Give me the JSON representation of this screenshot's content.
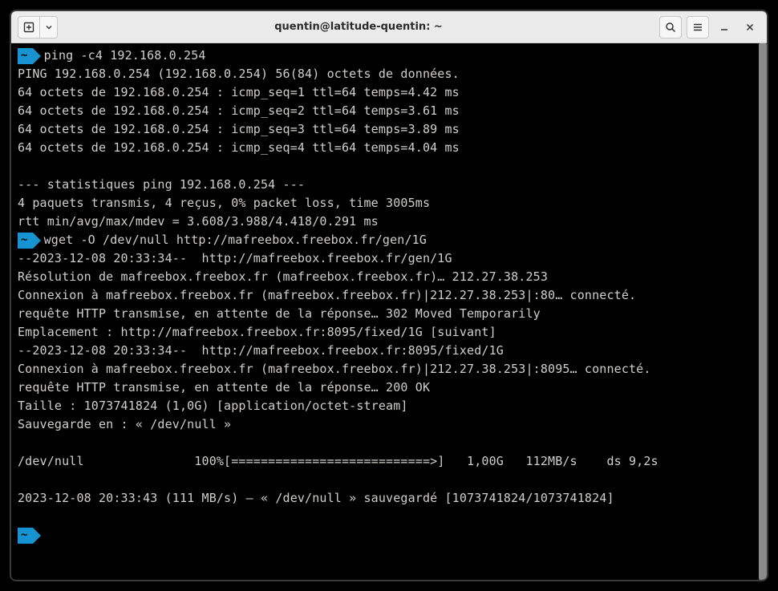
{
  "window": {
    "title": "quentin@latitude-quentin: ~"
  },
  "prompt": {
    "dir": "~"
  },
  "commands": {
    "ping": "ping -c4 192.168.0.254",
    "wget": "wget -O /dev/null http://mafreebox.freebox.fr/gen/1G"
  },
  "ping_output": {
    "header": "PING 192.168.0.254 (192.168.0.254) 56(84) octets de données.",
    "replies": [
      "64 octets de 192.168.0.254 : icmp_seq=1 ttl=64 temps=4.42 ms",
      "64 octets de 192.168.0.254 : icmp_seq=2 ttl=64 temps=3.61 ms",
      "64 octets de 192.168.0.254 : icmp_seq=3 ttl=64 temps=3.89 ms",
      "64 octets de 192.168.0.254 : icmp_seq=4 ttl=64 temps=4.04 ms"
    ],
    "stats_header": "--- statistiques ping 192.168.0.254 ---",
    "stats_summary": "4 paquets transmis, 4 reçus, 0% packet loss, time 3005ms",
    "stats_rtt": "rtt min/avg/max/mdev = 3.608/3.988/4.418/0.291 ms"
  },
  "wget_output": {
    "l1": "--2023-12-08 20:33:34--  http://mafreebox.freebox.fr/gen/1G",
    "l2": "Résolution de mafreebox.freebox.fr (mafreebox.freebox.fr)… 212.27.38.253",
    "l3": "Connexion à mafreebox.freebox.fr (mafreebox.freebox.fr)|212.27.38.253|:80… connecté.",
    "l4": "requête HTTP transmise, en attente de la réponse… 302 Moved Temporarily",
    "l5": "Emplacement : http://mafreebox.freebox.fr:8095/fixed/1G [suivant]",
    "l6": "--2023-12-08 20:33:34--  http://mafreebox.freebox.fr:8095/fixed/1G",
    "l7": "Connexion à mafreebox.freebox.fr (mafreebox.freebox.fr)|212.27.38.253|:8095… connecté.",
    "l8": "requête HTTP transmise, en attente de la réponse… 200 OK",
    "l9": "Taille : 1073741824 (1,0G) [application/octet-stream]",
    "l10": "Sauvegarde en : « /dev/null »",
    "progress": "/dev/null               100%[===========================>]   1,00G   112MB/s    ds 9,2s",
    "final": "2023-12-08 20:33:43 (111 MB/s) — « /dev/null » sauvegardé [1073741824/1073741824]"
  }
}
